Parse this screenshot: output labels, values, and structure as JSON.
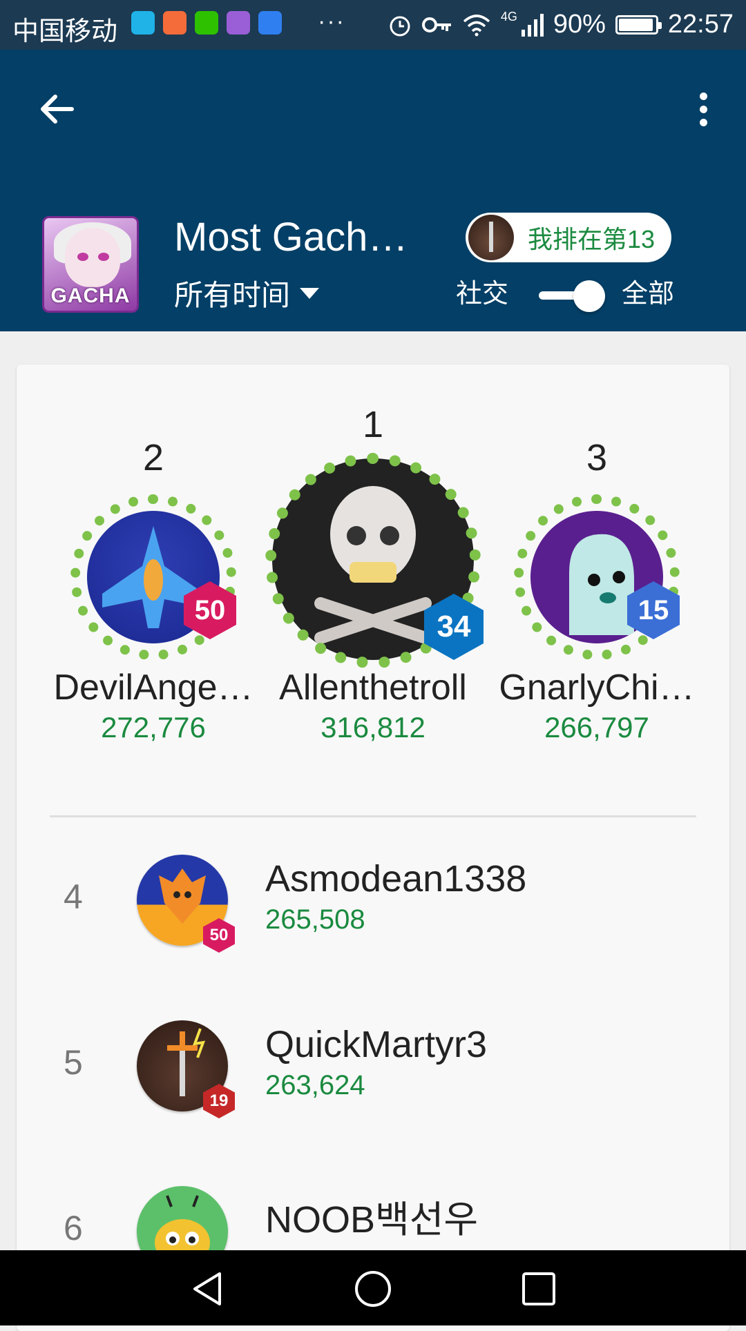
{
  "status_bar": {
    "carrier": "中国移动",
    "app_icons": [
      "tap-icon",
      "heart-app-icon",
      "wechat-icon",
      "gallery-icon",
      "tieba-icon"
    ],
    "overflow": "···",
    "network": "4G",
    "battery": "90%",
    "battery_level": 0.9,
    "time": "22:57"
  },
  "header": {
    "game_icon_text": "GACHA",
    "title": "Most Gacha…",
    "time_filter": "所有时间",
    "my_rank": "我排在第13",
    "social_label": "社交",
    "all_label": "全部",
    "toggle_on": true
  },
  "podium": [
    {
      "rank": "2",
      "name": "DevilAnge…",
      "score": "272,776",
      "level": "50",
      "level_color": "#d81b60"
    },
    {
      "rank": "1",
      "name": "Allenthetroll",
      "score": "316,812",
      "level": "34",
      "level_color": "#0a74c2"
    },
    {
      "rank": "3",
      "name": "GnarlyChi…",
      "score": "266,797",
      "level": "15",
      "level_color": "#3b6fd6"
    }
  ],
  "rows": [
    {
      "rank": "4",
      "name": "Asmodean1338",
      "score": "265,508",
      "level": "50",
      "level_color": "#d81b60"
    },
    {
      "rank": "5",
      "name": "QuickMartyr3",
      "score": "263,624",
      "level": "19",
      "level_color": "#c62828"
    },
    {
      "rank": "6",
      "name": "NOOB백선우",
      "score": "",
      "level": "",
      "level_color": "#c62828"
    }
  ],
  "colors": {
    "header_bg": "#033f66",
    "score_green": "#1a8a3f"
  }
}
